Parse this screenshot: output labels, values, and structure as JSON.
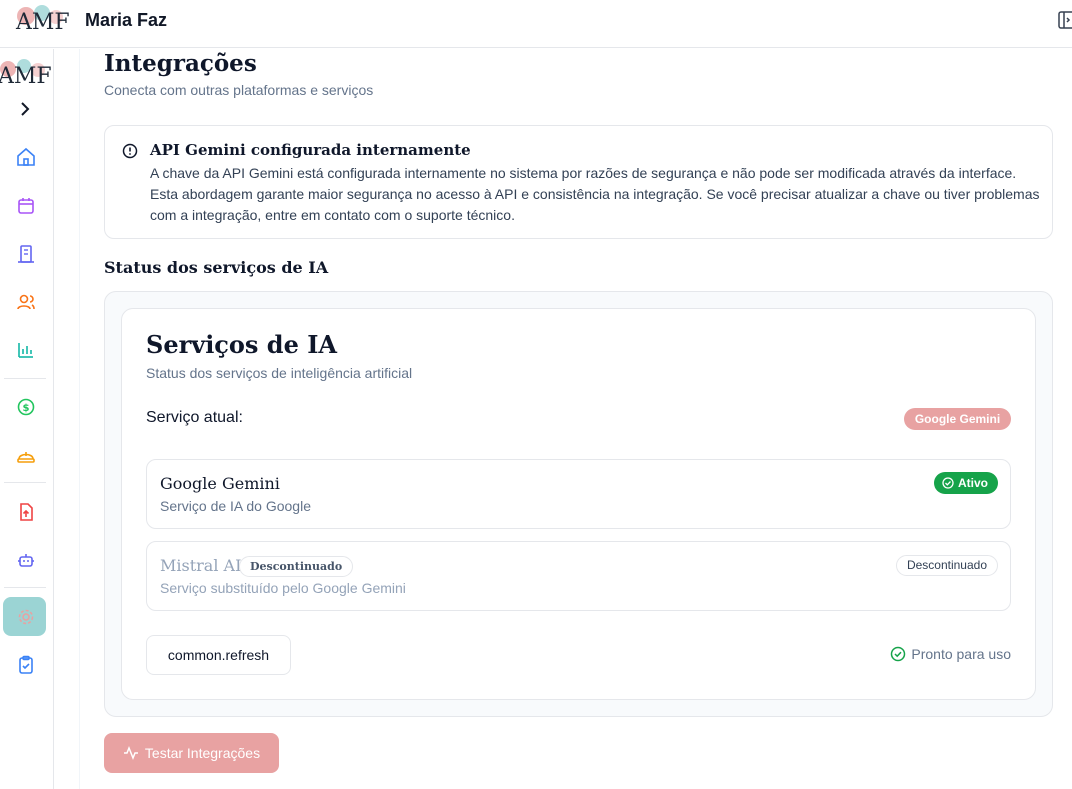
{
  "header": {
    "logo_text": "AMF",
    "brand": "Maria Faz",
    "icons": [
      "amf-logo",
      "panel-toggle-icon"
    ]
  },
  "sidebar": {
    "logo_text": "AMF",
    "toggle_icon": "chevron-right-icon",
    "items": [
      {
        "icon": "home-icon",
        "color": "#3b82f6"
      },
      {
        "icon": "calendar-icon",
        "color": "#a855f7"
      },
      {
        "icon": "building-icon",
        "color": "#6366f1"
      },
      {
        "icon": "users-icon",
        "color": "#f97316"
      },
      {
        "icon": "bar-chart-icon",
        "color": "#14b8a6"
      },
      {
        "icon": "dollar-circle-icon",
        "color": "#22c55e"
      },
      {
        "icon": "hard-hat-icon",
        "color": "#f59e0b"
      },
      {
        "icon": "file-upload-icon",
        "color": "#ef4444"
      },
      {
        "icon": "bot-icon",
        "color": "#6366f1"
      },
      {
        "icon": "settings-icon",
        "color": "#e8a2a2",
        "active": true
      },
      {
        "icon": "clipboard-check-icon",
        "color": "#3b82f6"
      }
    ]
  },
  "page": {
    "title": "Integrações",
    "subtitle": "Conecta com outras plataformas e serviços"
  },
  "alert": {
    "title": "API Gemini configurada internamente",
    "body": "A chave da API Gemini está configurada internamente no sistema por razões de segurança e não pode ser modificada através da interface. Esta abordagem garante maior segurança no acesso à API e consistência na integração. Se você precisar atualizar a chave ou tiver problemas com a integração, entre em contato com o suporte técnico."
  },
  "section": {
    "title": "Status dos serviços de IA"
  },
  "ai_card": {
    "title": "Serviços de IA",
    "subtitle": "Status dos serviços de inteligência artificial",
    "current_label": "Serviço atual:",
    "current_value": "Google Gemini",
    "services": [
      {
        "name": "Google Gemini",
        "description": "Serviço de IA do Google",
        "status": "Ativo"
      },
      {
        "name": "Mistral AI",
        "inline_badge": "Descontinuado",
        "description": "Serviço substituído pelo Google Gemini",
        "status": "Descontinuado"
      }
    ],
    "refresh_label": "common.refresh",
    "ready_text": "Pronto para uso"
  },
  "actions": {
    "test_label": "Testar Integrações"
  },
  "colors": {
    "accent": "#e8a2a2",
    "active_nav": "#9bd4d4",
    "success": "#16a34a"
  }
}
